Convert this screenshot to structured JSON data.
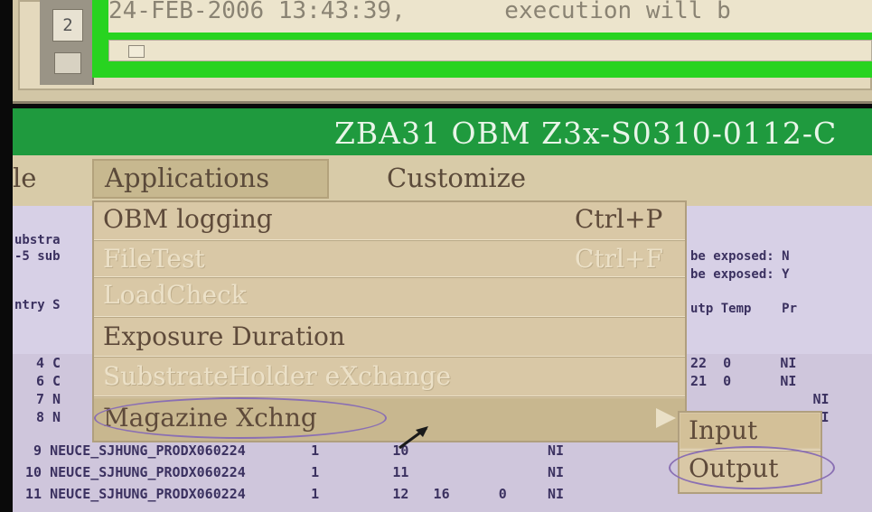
{
  "log_window": {
    "line_number": "2",
    "text": "24-FEB-2006 13:43:39,       execution will b"
  },
  "title": "ZBA31 OBM Z3x-S0310-0112-C",
  "menubar": {
    "file_partial": "le",
    "applications": "Applications",
    "customize": "Customize"
  },
  "content": {
    "left_lines": [
      "ubstra",
      "-5 sub",
      "ntry S"
    ],
    "right_lines": [
      "be exposed: N",
      "be exposed: Y",
      "utp Temp    Pr"
    ],
    "left_rows": [
      "4 C",
      "6 C",
      "7 N",
      "8 N"
    ],
    "right_rows": [
      "22  0      NI",
      "21  0      NI",
      "               NI",
      "               NI"
    ],
    "full_rows": [
      " 9 NEUCE_SJHUNG_PRODX060224        1         10                 NI",
      "10 NEUCE_SJHUNG_PRODX060224        1         11                 NI",
      "11 NEUCE_SJHUNG_PRODX060224        1         12   16      0     NI"
    ]
  },
  "applications_menu": {
    "items": [
      {
        "label": "OBM logging",
        "shortcut": "Ctrl+P",
        "enabled": true
      },
      {
        "label": "FileTest",
        "shortcut": "Ctrl+F",
        "enabled": false
      },
      {
        "label": "LoadCheck",
        "shortcut": "",
        "enabled": false
      },
      {
        "label": "Exposure Duration",
        "shortcut": "",
        "enabled": true
      },
      {
        "label": "SubstrateHolder eXchange",
        "shortcut": "",
        "enabled": false
      },
      {
        "label": "Magazine Xchng",
        "shortcut": "",
        "enabled": true
      }
    ]
  },
  "submenu": {
    "items": [
      "Input",
      "Output"
    ]
  },
  "colors": {
    "title_bar": "#1f9a3e",
    "log_panel": "#28d320",
    "menu_bg": "#d9c8a6",
    "highlight_ring": "#8a6fb3"
  }
}
